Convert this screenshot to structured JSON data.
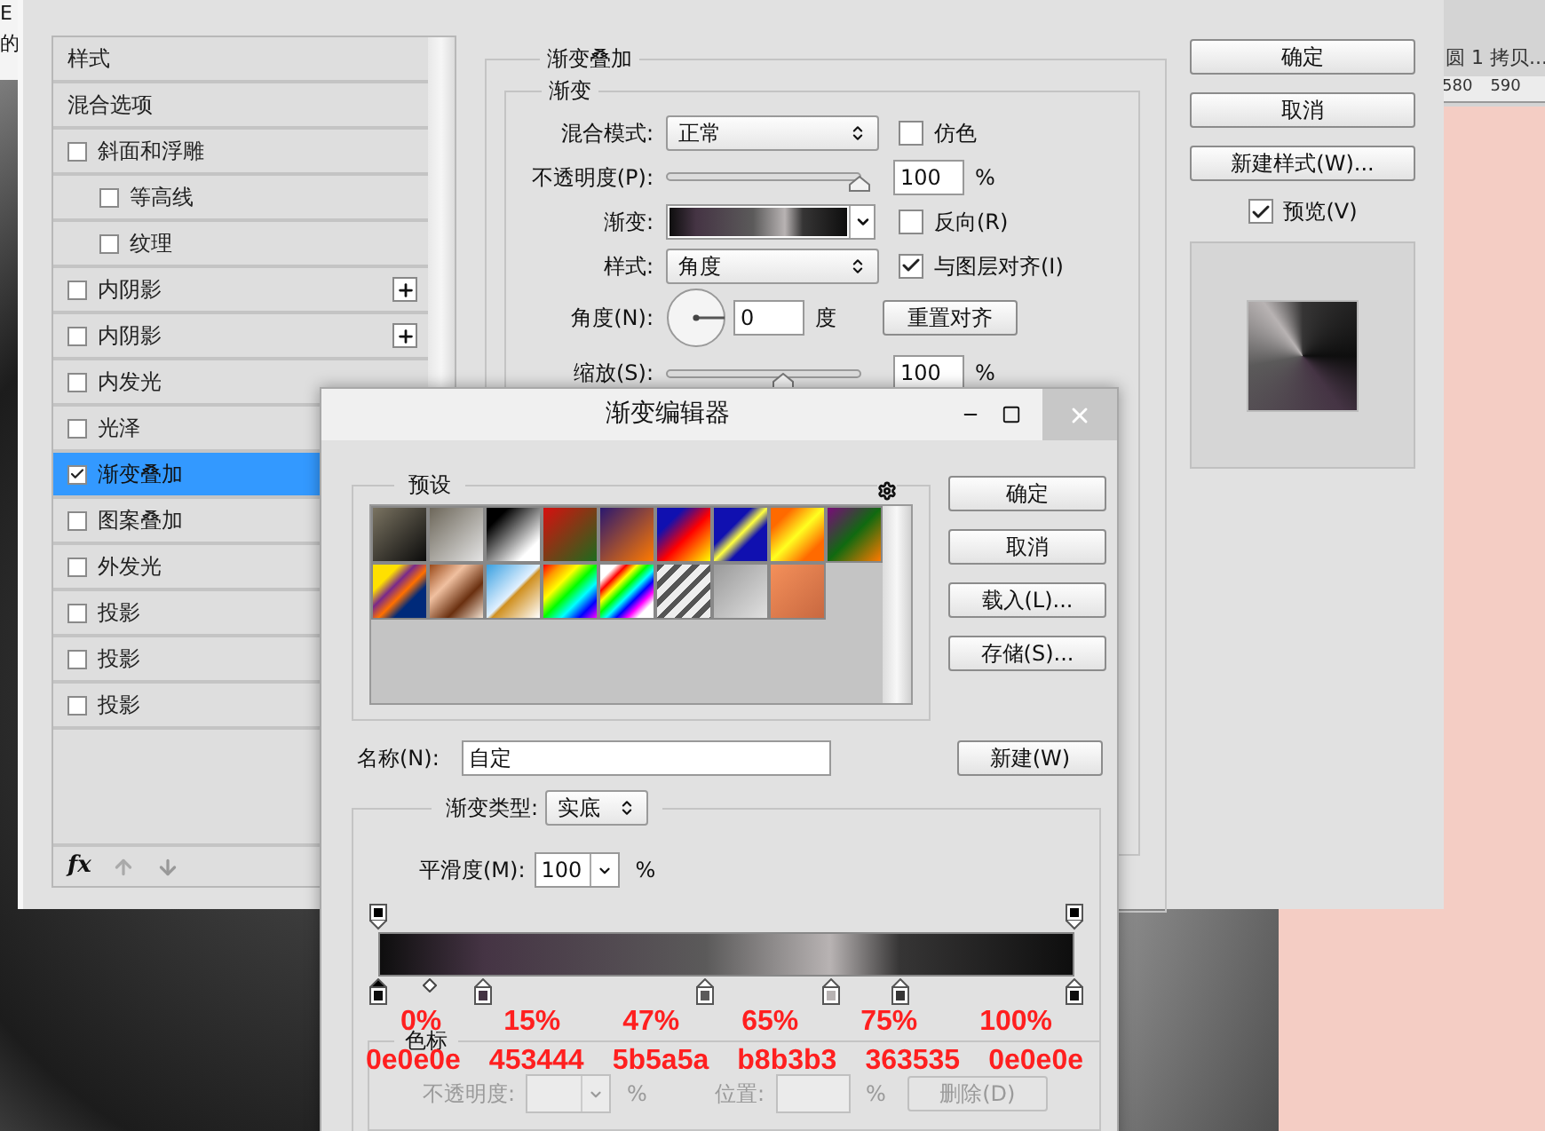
{
  "background": {
    "corner_text": "E",
    "side_text": "的",
    "document_tab": "圆 1 拷贝...",
    "ruler_labels": [
      "580",
      "590"
    ]
  },
  "layer_style": {
    "styles": [
      {
        "kind": "header",
        "label": "样式",
        "selected": false
      },
      {
        "kind": "option",
        "label": "混合选项",
        "selected": false
      },
      {
        "kind": "effect",
        "label": "斜面和浮雕",
        "checked": false,
        "selected": false,
        "children": [
          {
            "kind": "effect",
            "label": "等高线",
            "checked": false,
            "selected": false
          },
          {
            "kind": "effect",
            "label": "纹理",
            "checked": false,
            "selected": false
          }
        ]
      },
      {
        "kind": "effect",
        "label": "内阴影",
        "checked": false,
        "selected": false,
        "addable": true
      },
      {
        "kind": "effect",
        "label": "内阴影",
        "checked": false,
        "selected": false,
        "addable": true
      },
      {
        "kind": "effect",
        "label": "内发光",
        "checked": false,
        "selected": false
      },
      {
        "kind": "effect",
        "label": "光泽",
        "checked": false,
        "selected": false
      },
      {
        "kind": "effect",
        "label": "渐变叠加",
        "checked": true,
        "selected": true
      },
      {
        "kind": "effect",
        "label": "图案叠加",
        "checked": false,
        "selected": false
      },
      {
        "kind": "effect",
        "label": "外发光",
        "checked": false,
        "selected": false
      },
      {
        "kind": "effect",
        "label": "投影",
        "checked": false,
        "selected": false
      },
      {
        "kind": "effect",
        "label": "投影",
        "checked": false,
        "selected": false
      },
      {
        "kind": "effect",
        "label": "投影",
        "checked": false,
        "selected": false
      }
    ],
    "fx_label": "fx",
    "section_title": "渐变叠加",
    "group_title": "渐变",
    "blend_mode": {
      "label": "混合模式:",
      "value": "正常"
    },
    "dither": {
      "label": "仿色",
      "checked": false
    },
    "opacity": {
      "label": "不透明度(P):",
      "level": 1,
      "value": "100",
      "unit": "%"
    },
    "gradient": {
      "label": "渐变:"
    },
    "reverse": {
      "label": "反向(R)",
      "checked": false
    },
    "style": {
      "label": "样式:",
      "value": "角度"
    },
    "align": {
      "label": "与图层对齐(I)",
      "checked": true
    },
    "angle": {
      "label": "角度(N):",
      "value": "0",
      "unit": "度"
    },
    "reset_button": "重置对齐",
    "scale": {
      "label": "缩放(S):",
      "level": 0.6,
      "value": "100",
      "unit": "%"
    },
    "buttons": [
      "确定",
      "取消",
      "新建样式(W)..."
    ],
    "preview": {
      "label": "预览(V)",
      "checked": true
    }
  },
  "gradient_editor": {
    "title": "渐变编辑器",
    "presets_label": "预设",
    "buttons": [
      "确定",
      "取消",
      "载入(L)...",
      "存储(S)..."
    ],
    "name": {
      "label": "名称(N):",
      "value": "自定"
    },
    "new_button": "新建(W)",
    "type": {
      "label": "渐变类型:",
      "value": "实底"
    },
    "smoothness": {
      "label": "平滑度(M):",
      "value": "100",
      "unit": "%"
    },
    "opacity_stops": [
      {
        "level": 0
      },
      {
        "level": 1
      }
    ],
    "color_stops": [
      {
        "level": 0,
        "color": "#0e0e0e",
        "selected": true
      },
      {
        "level": 0.15,
        "color": "#453444",
        "selected": false
      },
      {
        "level": 0.47,
        "color": "#5b5a5a",
        "selected": false
      },
      {
        "level": 0.65,
        "color": "#b8b3b3",
        "selected": false
      },
      {
        "level": 0.75,
        "color": "#363535",
        "selected": false
      },
      {
        "level": 1,
        "color": "#0e0e0e",
        "selected": false
      }
    ],
    "annotations": {
      "positions": [
        "0%",
        "15%",
        "47%",
        "65%",
        "75%",
        "100%"
      ],
      "hex_codes": [
        "0e0e0e",
        "453444",
        "5b5a5a",
        "b8b3b3",
        "363535",
        "0e0e0e"
      ]
    },
    "stops_section": {
      "title": "色标",
      "opacity_label": "不透明度:",
      "opacity_unit": "%",
      "location_label": "位置:",
      "location_unit": "%",
      "delete_button": "删除(D)",
      "disabled": true
    }
  }
}
